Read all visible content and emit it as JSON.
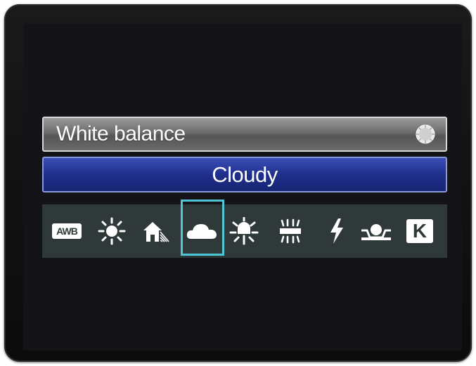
{
  "menu": {
    "title": "White balance",
    "selected_value": "Cloudy"
  },
  "wb_modes": [
    {
      "id": "auto",
      "icon": "awb-icon",
      "label": "AWB",
      "selected": false
    },
    {
      "id": "daylight",
      "icon": "sun-icon",
      "selected": false
    },
    {
      "id": "shade",
      "icon": "shade-house-icon",
      "selected": false
    },
    {
      "id": "cloudy",
      "icon": "cloud-icon",
      "selected": true
    },
    {
      "id": "tungsten",
      "icon": "tungsten-bulb-icon",
      "selected": false
    },
    {
      "id": "fluorescent",
      "icon": "fluorescent-icon",
      "selected": false
    },
    {
      "id": "flash",
      "icon": "flash-icon",
      "selected": false
    },
    {
      "id": "custom",
      "icon": "custom-wb-icon",
      "selected": false
    },
    {
      "id": "kelvin",
      "icon": "kelvin-icon",
      "label": "K",
      "selected": false
    }
  ],
  "colors": {
    "title_bar": "#7a7a7a",
    "value_bar": "#1f2f8a",
    "selection_frame": "#4ec6d8",
    "icon_strip": "#2f393a"
  }
}
